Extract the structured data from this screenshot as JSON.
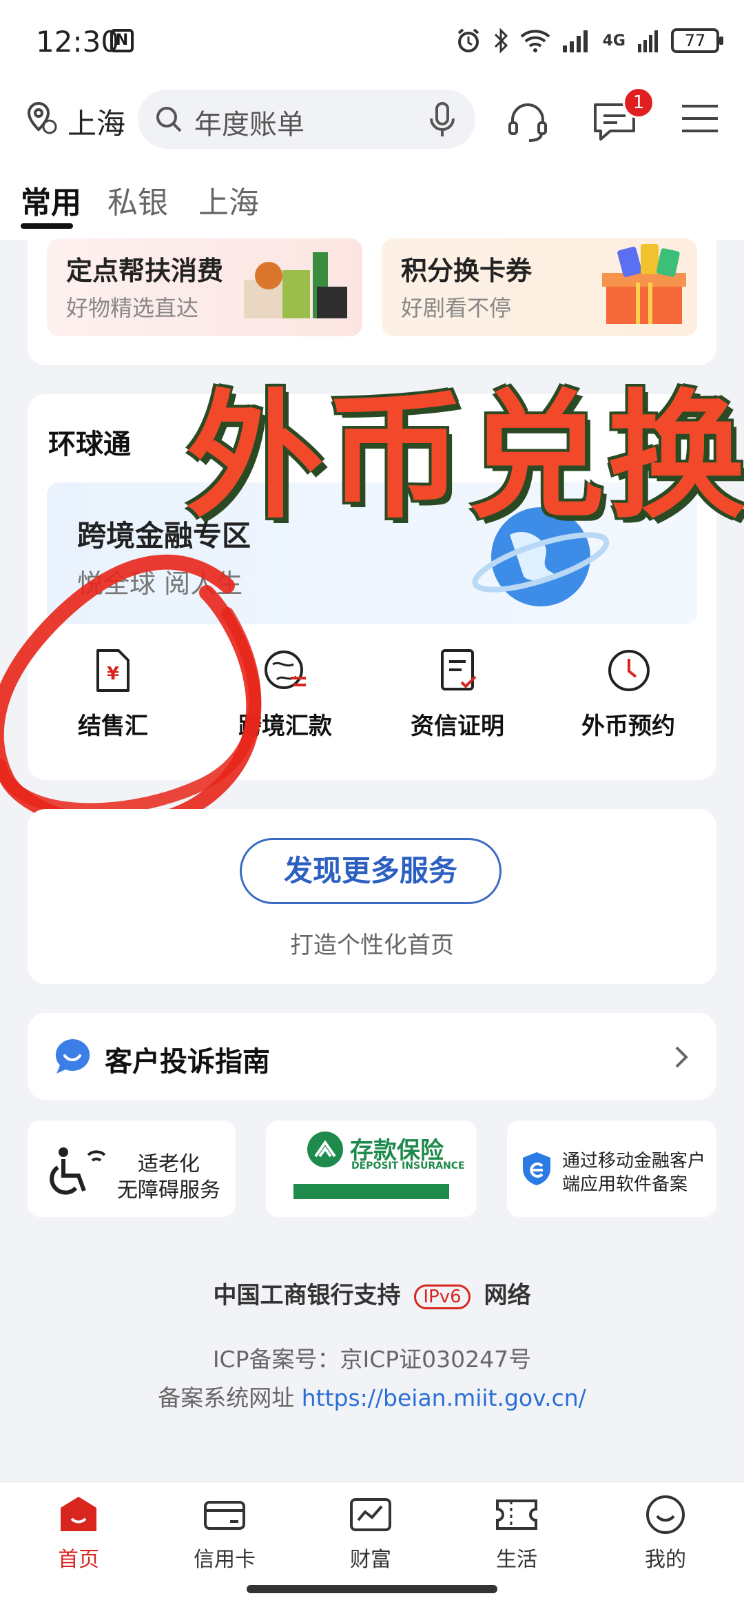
{
  "status_bar": {
    "time": "12:30",
    "nfc_label": "N",
    "network": "4G",
    "battery": "77"
  },
  "header": {
    "location": "上海",
    "search_placeholder": "年度账单",
    "message_badge": "1"
  },
  "tabs": [
    {
      "label": "常用",
      "active": true
    },
    {
      "label": "私银",
      "active": false
    },
    {
      "label": "上海",
      "active": false
    }
  ],
  "promos": [
    {
      "title": "定点帮扶消费",
      "subtitle": "好物精选直达"
    },
    {
      "title": "积分换卡券",
      "subtitle": "好剧看不停"
    }
  ],
  "global_section": {
    "title": "环球通",
    "banner_title": "跨境金融专区",
    "banner_subtitle": "悦全球 阅人生",
    "services": [
      {
        "label": "结售汇",
        "icon": "yuan-document-icon"
      },
      {
        "label": "跨境汇款",
        "icon": "globe-transfer-icon"
      },
      {
        "label": "资信证明",
        "icon": "certificate-icon"
      },
      {
        "label": "外币预约",
        "icon": "clock-icon"
      }
    ]
  },
  "overlay": {
    "caption": "外币兑换"
  },
  "discover": {
    "button": "发现更多服务",
    "subtitle": "打造个性化首页"
  },
  "complaint": {
    "title": "客户投诉指南"
  },
  "badges": {
    "elderly_line1": "适老化",
    "elderly_line2": "无障碍服务",
    "deposit_cn": "存款保险",
    "deposit_en": "DEPOSIT INSURANCE",
    "app_filing_line1": "通过移动金融客户",
    "app_filing_line2": "端应用软件备案"
  },
  "footer": {
    "ipv6_prefix": "中国工商银行支持",
    "ipv6_badge": "IPv6",
    "ipv6_suffix": "网络",
    "icp": "ICP备案号：京ICP证030247号",
    "record_prefix": "备案系统网址",
    "record_url": "https://beian.miit.gov.cn/"
  },
  "bottom_nav": [
    {
      "label": "首页",
      "active": true
    },
    {
      "label": "信用卡",
      "active": false
    },
    {
      "label": "财富",
      "active": false
    },
    {
      "label": "生活",
      "active": false
    },
    {
      "label": "我的",
      "active": false
    }
  ],
  "colors": {
    "brand_red": "#d8261e",
    "link_blue": "#2b6fd6",
    "button_blue": "#3b6bc4",
    "deposit_green": "#1e8a4c"
  }
}
